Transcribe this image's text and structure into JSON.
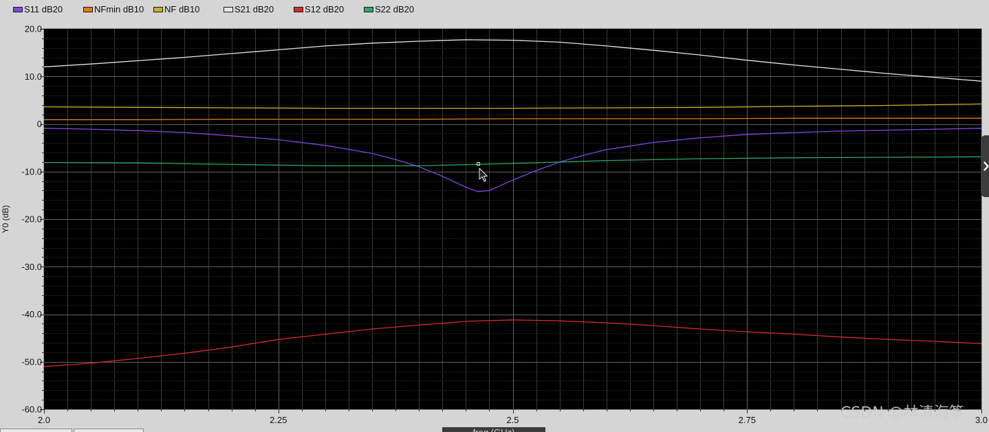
{
  "ui": {
    "watermark": "CSDN @林清海筝",
    "panel_handle_icon": "chevron-right-icon",
    "cursor_icon": "mouse-pointer-icon"
  },
  "chart_data": {
    "type": "line",
    "xlabel": "freq (GHz)",
    "ylabel": "Y0 (dB)",
    "xlim": [
      2.0,
      3.0
    ],
    "ylim": [
      -60,
      20
    ],
    "x_ticks": [
      "2.0",
      "2.25",
      "2.5",
      "2.75",
      "3.0"
    ],
    "y_ticks": [
      "20.0",
      "10.0",
      "0",
      "-10.0",
      "-20.0",
      "-30.0",
      "-40.0",
      "-50.0",
      "-60.0"
    ],
    "grid": true,
    "legend": "top-left",
    "plot_background": "#000000",
    "series": [
      {
        "name": "S11 dB20",
        "color": "#8446e2",
        "x": [
          2.0,
          2.05,
          2.1,
          2.15,
          2.2,
          2.25,
          2.3,
          2.35,
          2.375,
          2.4,
          2.425,
          2.45,
          2.4625,
          2.475,
          2.5,
          2.525,
          2.55,
          2.575,
          2.6,
          2.65,
          2.7,
          2.75,
          2.8,
          2.85,
          2.9,
          2.95,
          3.0
        ],
        "y": [
          -0.9,
          -1.1,
          -1.4,
          -1.8,
          -2.5,
          -3.3,
          -4.5,
          -6.2,
          -7.5,
          -9.0,
          -11.0,
          -13.3,
          -14.2,
          -14.0,
          -11.8,
          -9.8,
          -8.0,
          -6.6,
          -5.4,
          -3.9,
          -2.9,
          -2.2,
          -1.8,
          -1.5,
          -1.3,
          -1.1,
          -0.9
        ]
      },
      {
        "name": "NFmin dB10",
        "color": "#e07c1e",
        "x": [
          2.0,
          2.1,
          2.2,
          2.3,
          2.4,
          2.5,
          2.6,
          2.7,
          2.8,
          2.9,
          3.0
        ],
        "y": [
          0.9,
          0.9,
          1.0,
          1.0,
          1.0,
          1.1,
          1.1,
          1.1,
          1.2,
          1.2,
          1.2
        ]
      },
      {
        "name": "NF dB10",
        "color": "#c9b22a",
        "x": [
          2.0,
          2.1,
          2.2,
          2.3,
          2.4,
          2.5,
          2.6,
          2.7,
          2.8,
          2.9,
          3.0
        ],
        "y": [
          3.6,
          3.5,
          3.4,
          3.3,
          3.3,
          3.3,
          3.4,
          3.5,
          3.7,
          3.9,
          4.2
        ]
      },
      {
        "name": "S21 dB20",
        "color": "#e6e6e6",
        "x": [
          2.0,
          2.05,
          2.1,
          2.15,
          2.2,
          2.25,
          2.3,
          2.35,
          2.4,
          2.45,
          2.5,
          2.55,
          2.6,
          2.65,
          2.7,
          2.75,
          2.8,
          2.85,
          2.9,
          2.95,
          3.0
        ],
        "y": [
          12.0,
          12.6,
          13.3,
          14.0,
          14.8,
          15.6,
          16.4,
          17.0,
          17.4,
          17.7,
          17.6,
          17.2,
          16.4,
          15.5,
          14.5,
          13.4,
          12.4,
          11.5,
          10.6,
          9.8,
          9.0
        ]
      },
      {
        "name": "S12 dB20",
        "color": "#d22b2b",
        "x": [
          2.0,
          2.05,
          2.1,
          2.15,
          2.2,
          2.25,
          2.3,
          2.35,
          2.4,
          2.45,
          2.5,
          2.55,
          2.6,
          2.65,
          2.7,
          2.75,
          2.8,
          2.85,
          2.9,
          2.95,
          3.0
        ],
        "y": [
          -51.0,
          -50.3,
          -49.3,
          -48.2,
          -46.9,
          -45.3,
          -44.2,
          -43.1,
          -42.3,
          -41.5,
          -41.2,
          -41.4,
          -41.8,
          -42.4,
          -43.1,
          -43.7,
          -44.2,
          -44.8,
          -45.3,
          -45.7,
          -46.2
        ]
      },
      {
        "name": "S22 dB20",
        "color": "#2fa56a",
        "x": [
          2.0,
          2.1,
          2.2,
          2.3,
          2.4,
          2.5,
          2.6,
          2.7,
          2.8,
          2.9,
          3.0
        ],
        "y": [
          -8.1,
          -8.2,
          -8.5,
          -8.8,
          -8.8,
          -8.3,
          -7.7,
          -7.3,
          -7.1,
          -7.0,
          -6.9
        ]
      }
    ]
  }
}
